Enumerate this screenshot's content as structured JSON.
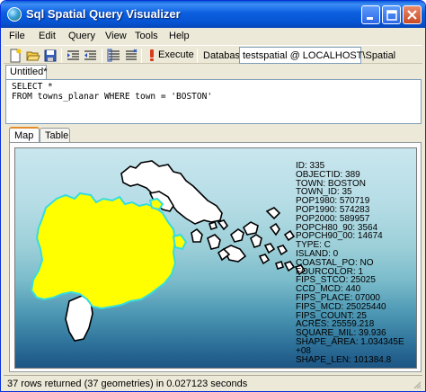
{
  "window": {
    "title": "Sql Spatial Query Visualizer"
  },
  "menu": {
    "items": [
      "File",
      "Edit",
      "Query",
      "View",
      "Tools",
      "Help"
    ]
  },
  "toolbar": {
    "execute_label": "Execute",
    "database_label": "Database:",
    "database_value": "testspatial @ LOCALHOST\\Spatial"
  },
  "document_tab": {
    "label": "Untitled*"
  },
  "query": {
    "lines": [
      "SELECT *",
      "FROM towns_planar WHERE town = 'BOSTON'"
    ]
  },
  "result_tabs": [
    "Map",
    "Table"
  ],
  "info": {
    "lines": [
      "ID: 335",
      "OBJECTID: 389",
      "TOWN: BOSTON",
      "TOWN_ID: 35",
      "POP1980: 570719",
      "POP1990: 574283",
      "POP2000: 589957",
      "POPCH80_90: 3564",
      "POPCH90_00: 14674",
      "TYPE: C",
      "ISLAND: 0",
      "COASTAL_PO: NO",
      "FOURCOLOR: 1",
      "FIPS_STCO: 25025",
      "CCD_MCD: 440",
      "FIPS_PLACE: 07000",
      "FIPS_MCD: 25025440",
      "FIPS_COUNT: 25",
      "ACRES: 25559.218",
      "SQUARE_MIL: 39.936",
      "SHAPE_AREA: 1.034345E",
      "+08",
      "SHAPE_LEN: 101384.8"
    ]
  },
  "status": {
    "text": "37 rows returned (37 geometries) in 0.027123 seconds"
  },
  "colors": {
    "selected_fill": "#ffff00",
    "selected_outline": "#33dde0",
    "unselected_fill": "#ffffff",
    "map_outline": "#000000"
  }
}
